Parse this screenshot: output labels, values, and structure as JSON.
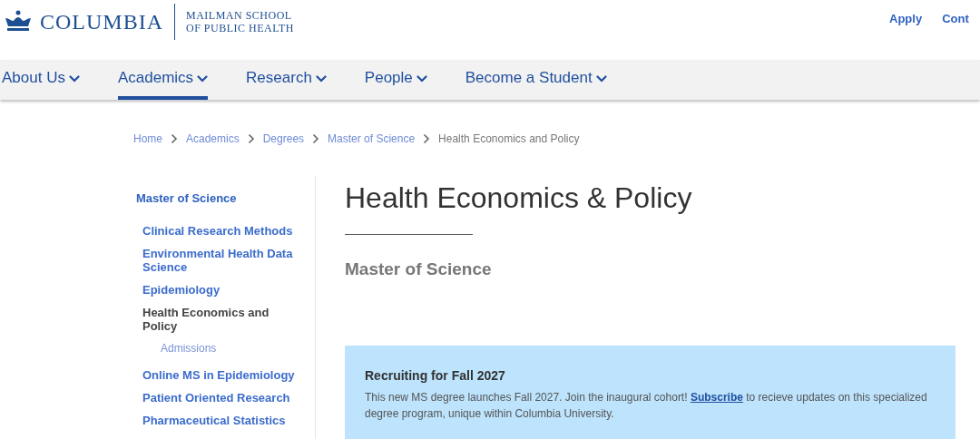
{
  "header": {
    "logo_wordmark": "COLUMBIA",
    "school_lines": [
      "MAILMAN SCHOOL",
      "OF PUBLIC HEALTH"
    ],
    "utility_links": [
      "Apply",
      "Cont"
    ]
  },
  "nav": [
    {
      "label": "About Us",
      "selected": false
    },
    {
      "label": "Academics",
      "selected": true
    },
    {
      "label": "Research",
      "selected": false
    },
    {
      "label": "People",
      "selected": false
    },
    {
      "label": "Become a Student",
      "selected": false
    }
  ],
  "breadcrumb": [
    "Home",
    "Academics",
    "Degrees",
    "Master of Science",
    "Health Economics and Policy"
  ],
  "sidebar": {
    "heading": "Master of Science",
    "items": [
      {
        "label": "Clinical Research Methods",
        "selected": false
      },
      {
        "label": "Environmental Health Data Science",
        "selected": false
      },
      {
        "label": "Epidemiology",
        "selected": false
      },
      {
        "label": "Health Economics and Policy",
        "selected": true,
        "children": [
          {
            "label": "Admissions",
            "selected": false
          }
        ]
      },
      {
        "label": "Online MS in Epidemiology",
        "selected": false
      },
      {
        "label": "Patient Oriented Research",
        "selected": false
      },
      {
        "label": "Pharmaceutical Statistics",
        "selected": false
      }
    ]
  },
  "page": {
    "title": "Health Economics & Policy",
    "subtitle": "Master of Science"
  },
  "notice": {
    "title": "Recruiting for Fall 2027",
    "text_before": "This new MS degree launches Fall 2027. Join the inaugural cohort! ",
    "link": "Subscribe",
    "text_after": " to recieve updates on this specialized degree program, unique within Columbia University."
  }
}
